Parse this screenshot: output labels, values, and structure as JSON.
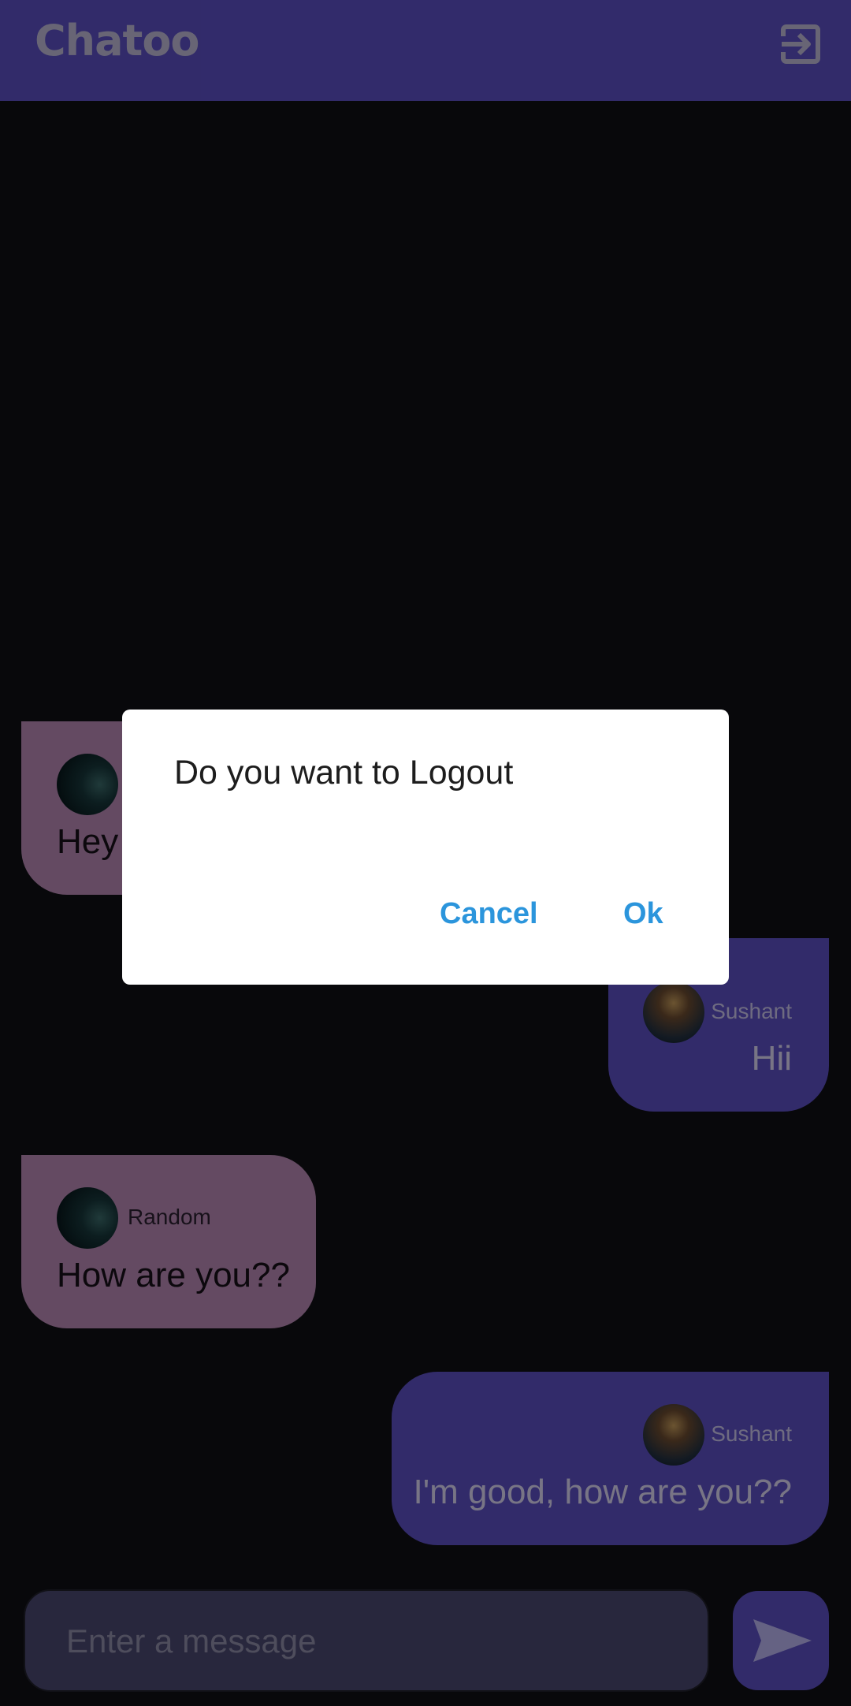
{
  "app": {
    "title": "Chatoo",
    "logout_icon": "logout-icon",
    "accent_color": "#5b4fc2",
    "incoming_bubble_color": "#b688b3"
  },
  "messages": [
    {
      "direction": "incoming",
      "sender": "",
      "text": "Hey",
      "avatar": "dark-avatar"
    },
    {
      "direction": "outgoing",
      "sender": "Sushant",
      "text": "Hii",
      "avatar": "photo-avatar"
    },
    {
      "direction": "incoming",
      "sender": "Random",
      "text": "How are you??",
      "avatar": "dark-avatar"
    },
    {
      "direction": "outgoing",
      "sender": "Sushant",
      "text": "I'm good, how are you??",
      "avatar": "photo-avatar"
    }
  ],
  "composer": {
    "placeholder": "Enter a message",
    "value": "",
    "send_icon": "send-icon"
  },
  "dialog": {
    "title": "Do you want to Logout",
    "cancel_label": "Cancel",
    "ok_label": "Ok",
    "button_color": "#2b95dc"
  }
}
